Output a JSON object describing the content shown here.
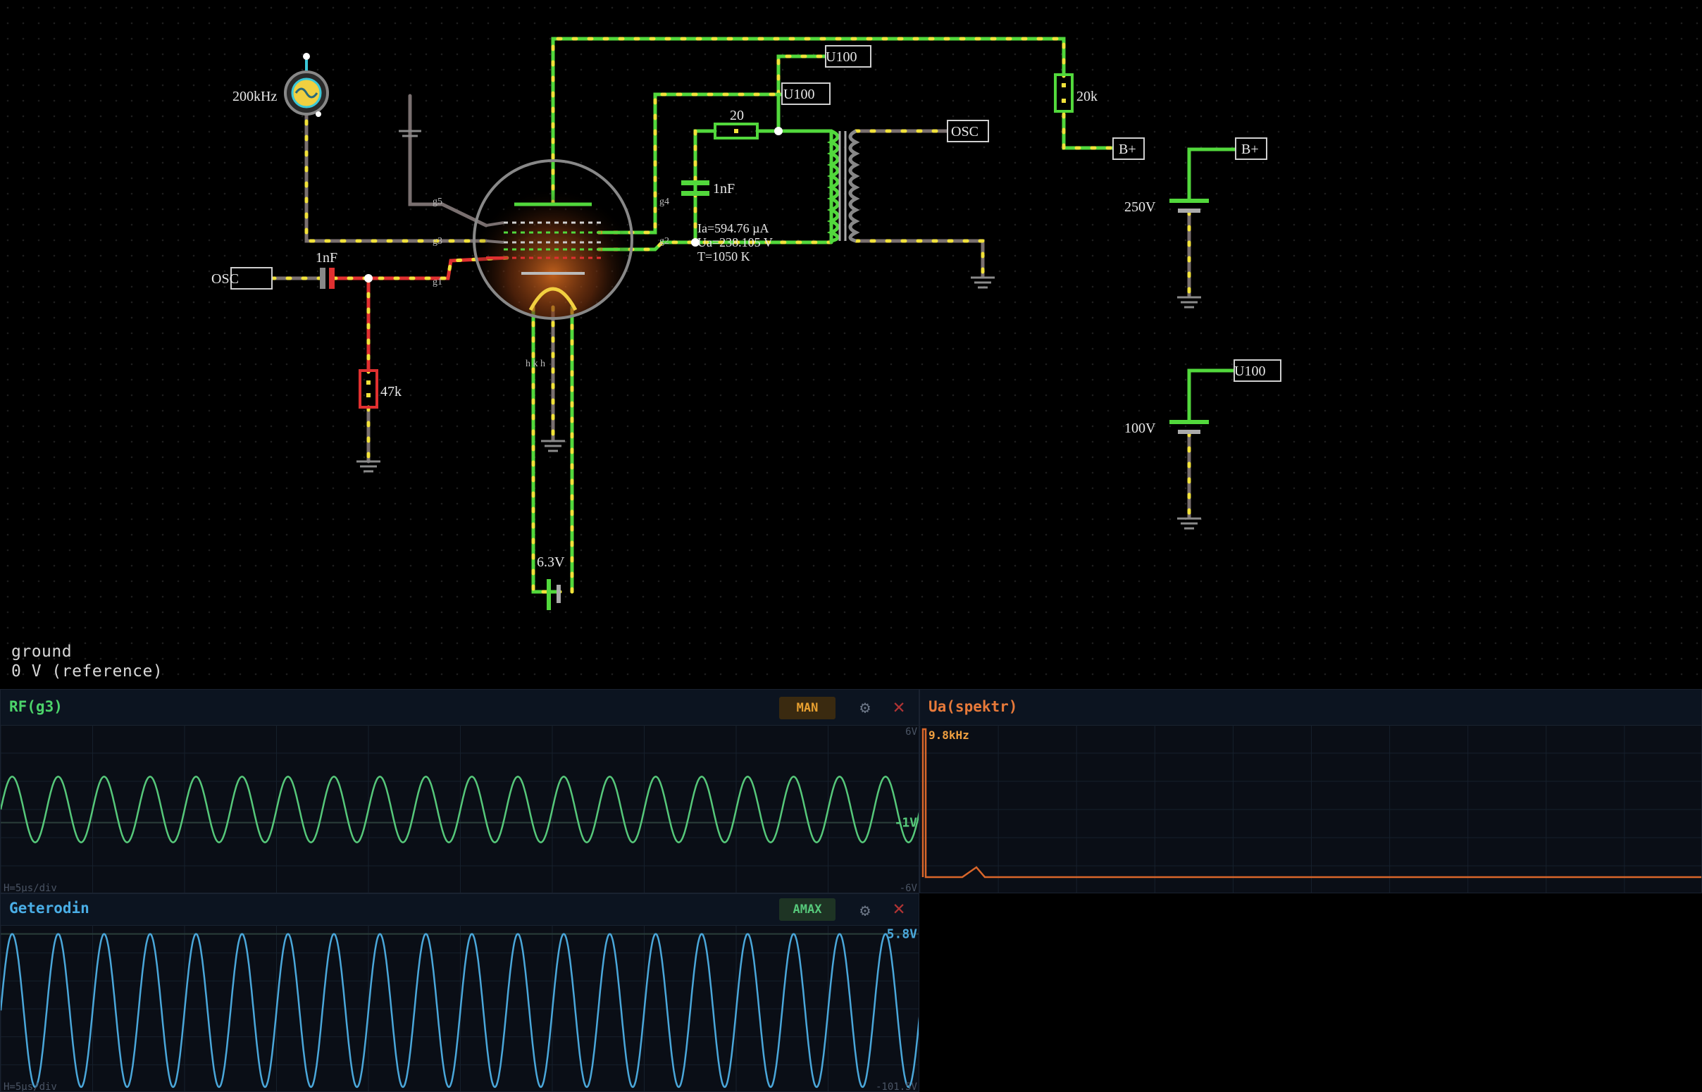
{
  "circuit": {
    "labels": {
      "generator_freq": "200kHz",
      "osc_in": "OSC",
      "osc_out": "OSC",
      "coupling_cap": "1nF",
      "grid_resistor": "47k",
      "g5": "g5",
      "g4": "g4",
      "g3": "g3",
      "g2": "g2",
      "g1": "g1",
      "anode_resistor": "20",
      "bypass_cap": "1nF",
      "b_plus_resistor": "20k",
      "u100_a": "U100",
      "u100_b": "U100",
      "u100_c": "U100",
      "b_plus_a": "B+",
      "b_plus_b": "B+",
      "v250": "250V",
      "v100": "100V",
      "heater_v": "6.3V",
      "heater_pins": "h  k  h"
    },
    "tube_readout": {
      "ia": "Ia=594.76 µA",
      "ua": "Ua=238.105 V",
      "t": "T=1050 K"
    }
  },
  "status": {
    "node": "ground",
    "value": "0 V (reference)"
  },
  "scopes": [
    {
      "title": "RF(g3)",
      "mode": "MAN",
      "title_color": "#4cd36a",
      "trace_color": "#56c87a",
      "y_top": "6V",
      "y_bottom": "-6V",
      "marker": "-1V",
      "hdiv": "H=5µs/div",
      "cycles": 20,
      "amplitude_v": 2.5,
      "offset_v": 0,
      "range_v": [
        -6,
        6
      ]
    },
    {
      "title": "Geterodin",
      "mode": "AMAX",
      "title_color": "#4aaee6",
      "trace_color": "#4aa7da",
      "y_top": "",
      "y_bottom": "-101.5V",
      "marker": "5.8V",
      "hdiv": "H=5µs/div",
      "cycles": 20,
      "amplitude_v": 53.65,
      "offset_v": -47.85,
      "range_v": [
        -101.5,
        8.1
      ]
    }
  ],
  "spectrum": {
    "title": "Ua(spektr)",
    "title_color": "#e87a3a",
    "peak_label": "9.8kHz",
    "trace_color": "#d9662a",
    "peak_label_color": "#f0a040"
  },
  "icons": {
    "gear": "⚙",
    "close": "✕"
  }
}
